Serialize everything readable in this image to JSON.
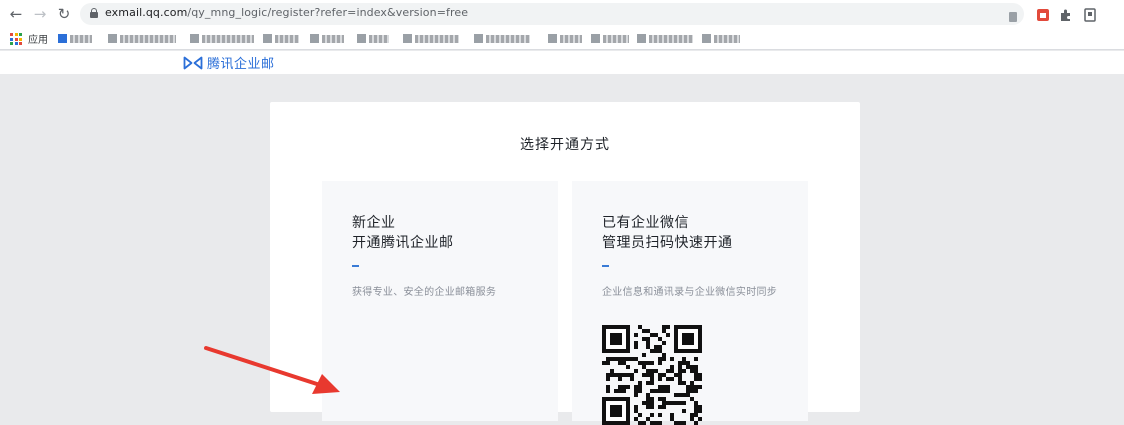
{
  "browser": {
    "url_host": "exmail.qq.com",
    "url_path": "/qy_mng_logic/register?refer=index&version=free",
    "bookmarks_apps_label": "应用"
  },
  "site": {
    "logo_text": "腾讯企业邮",
    "brand_color": "#2b6fd8"
  },
  "card": {
    "title": "选择开通方式",
    "options": [
      {
        "title_line1": "新企业",
        "title_line2": "开通腾讯企业邮",
        "description": "获得专业、安全的企业邮箱服务"
      },
      {
        "title_line1": "已有企业微信",
        "title_line2": "管理员扫码快速开通",
        "description": "企业信息和通讯录与企业微信实时同步"
      }
    ]
  },
  "colors": {
    "page_bg": "#e9eaec",
    "accent": "#3a7bd5",
    "arrow": "#e8392f"
  }
}
